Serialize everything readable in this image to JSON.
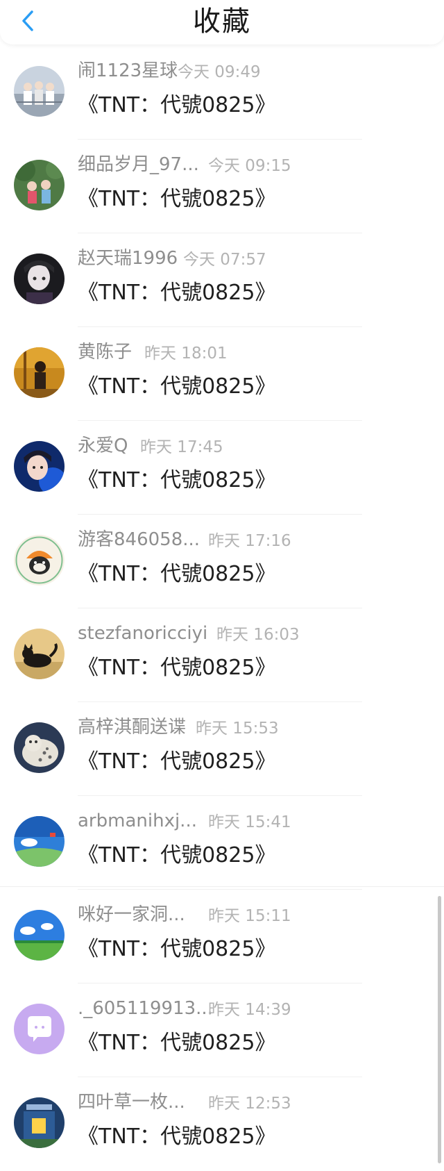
{
  "header": {
    "title": "收藏",
    "back_icon": "chevron-left-icon",
    "accent_color": "#2a9df4"
  },
  "items": [
    {
      "name": "闹1123星球",
      "time": "今天 09:49",
      "content": "《TNT：代號0825》"
    },
    {
      "name": "细品岁月_97...",
      "time": "今天 09:15",
      "content": "《TNT：代號0825》"
    },
    {
      "name": "赵天瑞1996",
      "time": "今天 07:57",
      "content": "《TNT：代號0825》"
    },
    {
      "name": "黄陈子",
      "time": "昨天 18:01",
      "content": "《TNT：代號0825》"
    },
    {
      "name": "永爱Q",
      "time": "昨天 17:45",
      "content": "《TNT：代號0825》"
    },
    {
      "name": "游客846058...",
      "time": "昨天 17:16",
      "content": "《TNT：代號0825》"
    },
    {
      "name": "stezfanoricciyi",
      "time": "昨天 16:03",
      "content": "《TNT：代號0825》"
    },
    {
      "name": "高梓淇酮送谍",
      "time": "昨天 15:53",
      "content": "《TNT：代號0825》"
    },
    {
      "name": "arbmanihxj...",
      "time": "昨天 15:41",
      "content": "《TNT：代號0825》"
    },
    {
      "name": "咪好一家洞...",
      "time": "昨天 15:11",
      "content": "《TNT：代號0825》"
    },
    {
      "name": "._605119913...",
      "time": "昨天 14:39",
      "content": "《TNT：代號0825》"
    },
    {
      "name": "四叶草一枚...",
      "time": "昨天 12:53",
      "content": "《TNT：代號0825》"
    }
  ]
}
